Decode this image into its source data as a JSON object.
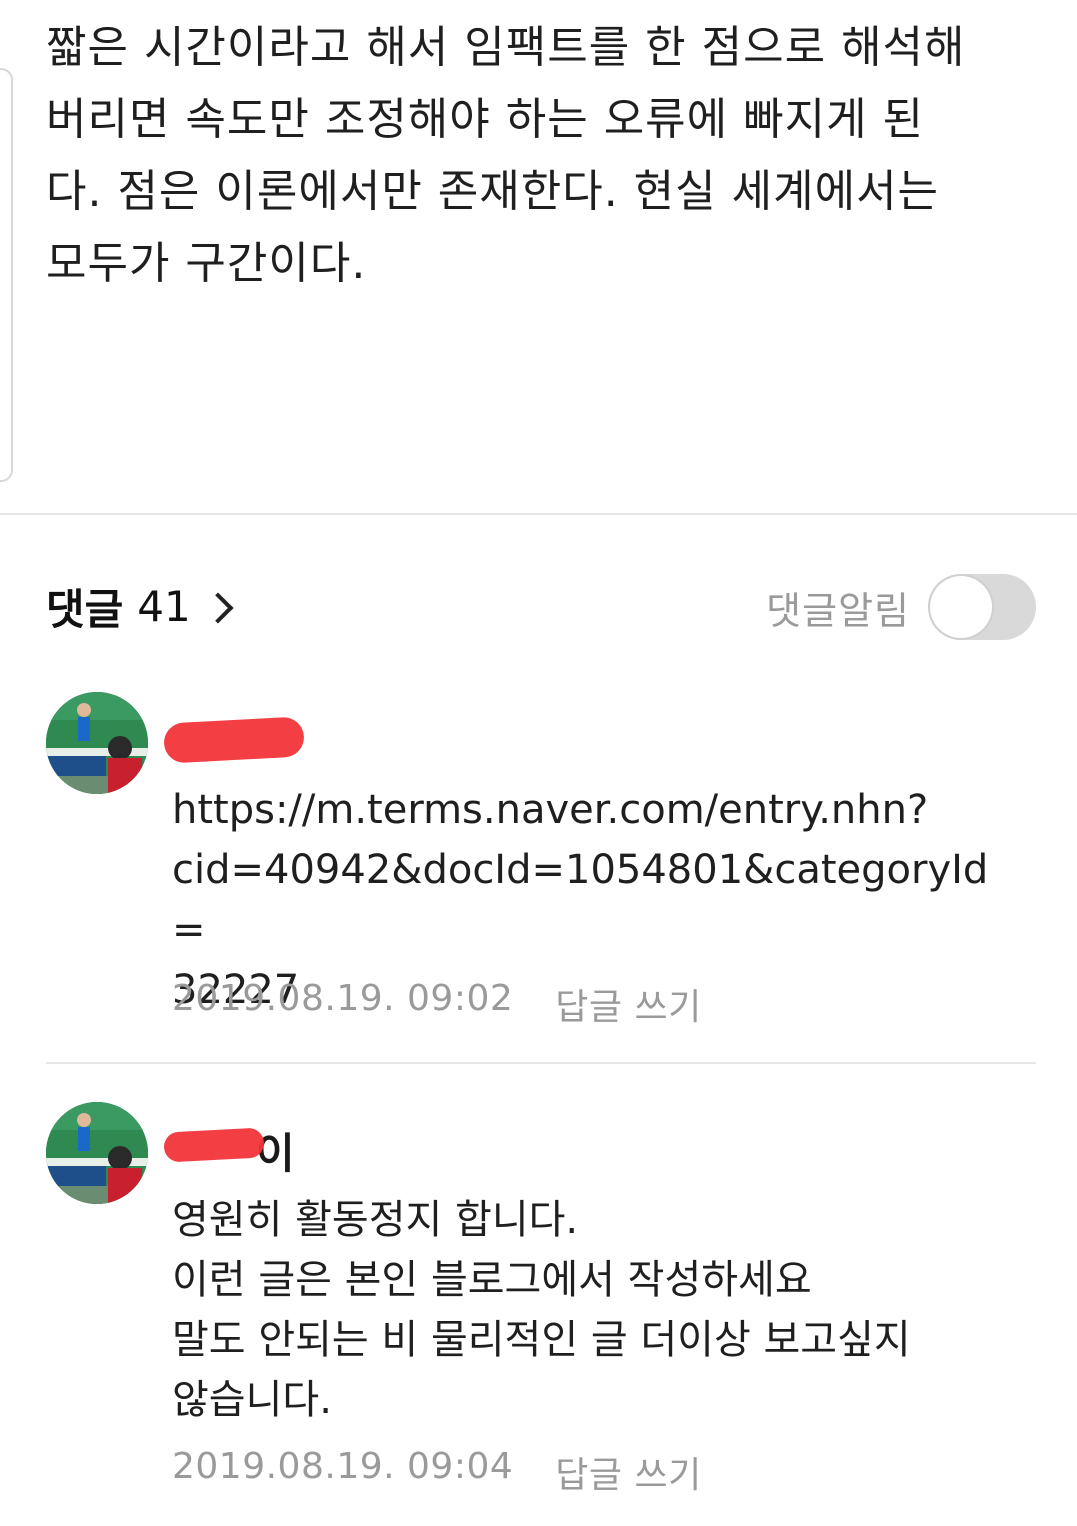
{
  "article": {
    "lines": [
      "짧은 시간이라고 해서 임팩트를 한 점으로 해석해",
      "버리면 속도만 조정해야 하는 오류에 빠지게 된",
      "다. 점은 이론에서만 존재한다. 현실 세계에서는",
      "모두가 구간이다."
    ]
  },
  "comments_header": {
    "title": "댓글",
    "count": "41",
    "notify_label": "댓글알림",
    "notify_on": false
  },
  "comments": [
    {
      "author_visible": "",
      "lines": [
        "https://m.terms.naver.com/entry.nhn?",
        "cid=40942&docId=1054801&categoryId=",
        "32227"
      ],
      "timestamp": "2019.08.19. 09:02",
      "reply_label": "답글 쓰기"
    },
    {
      "author_visible": "이",
      "lines": [
        "영원히 활동정지 합니다.",
        "이런 글은 본인 블로그에서 작성하세요",
        "말도 안되는 비 물리적인 글 더이상 보고싶지",
        "않습니다."
      ],
      "timestamp": "2019.08.19. 09:04",
      "reply_label": "답글 쓰기"
    }
  ],
  "colors": {
    "redaction": "#f2343a",
    "muted_text": "#9a9a9a",
    "toggle_off": "#d9d9d9"
  }
}
